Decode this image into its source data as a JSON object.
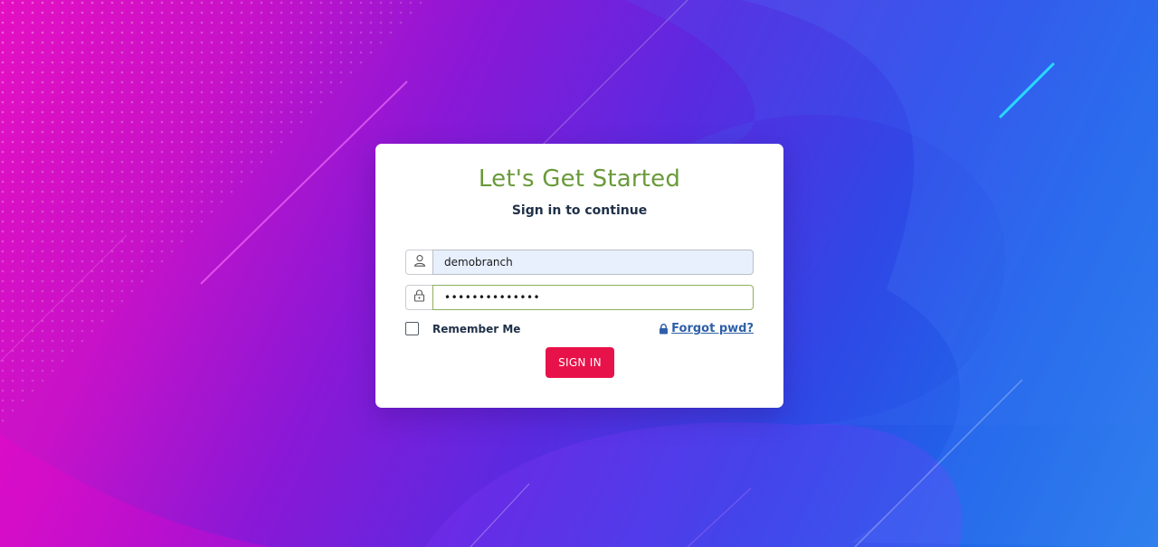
{
  "login": {
    "title": "Let's Get Started",
    "subtitle": "Sign in to continue",
    "username_value": "demobranch",
    "password_value": "••••••••••••••",
    "remember_label": "Remember Me",
    "remember_checked": false,
    "forgot_label": "Forgot pwd?",
    "signin_label": "SIGN IN"
  },
  "icons": {
    "username": "user-icon",
    "password": "lock-icon",
    "forgot": "lock-icon"
  },
  "colors": {
    "title": "#6a9a3a",
    "button": "#e8124a",
    "link": "#2e5fa8"
  }
}
